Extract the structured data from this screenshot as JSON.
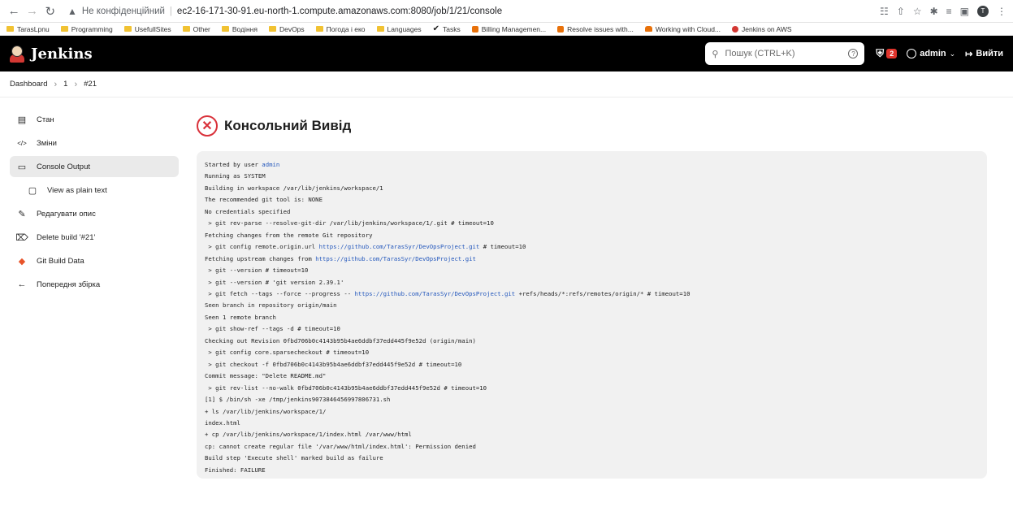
{
  "browser": {
    "insecure_label": "Не конфіденційний",
    "url": "ec2-16-171-30-91.eu-north-1.compute.amazonaws.com:8080/job/1/21/console",
    "profile_initial": "T",
    "bookmarks": [
      {
        "label": "TarasLpnu",
        "icon": "folder-icon"
      },
      {
        "label": "Programming",
        "icon": "folder-icon"
      },
      {
        "label": "UsefullSites",
        "icon": "folder-icon"
      },
      {
        "label": "Other",
        "icon": "folder-icon"
      },
      {
        "label": "Водіння",
        "icon": "folder-icon"
      },
      {
        "label": "DevOps",
        "icon": "folder-icon"
      },
      {
        "label": "Погода і еко",
        "icon": "folder-icon"
      },
      {
        "label": "Languages",
        "icon": "folder-icon"
      },
      {
        "label": "Tasks",
        "icon": "check-icon"
      },
      {
        "label": "Billing Managemen...",
        "icon": "aws-icon"
      },
      {
        "label": "Resolve issues with...",
        "icon": "aws-icon"
      },
      {
        "label": "Working with Cloud...",
        "icon": "cloud-icon"
      },
      {
        "label": "Jenkins on AWS",
        "icon": "jenkins-icon"
      }
    ]
  },
  "header": {
    "brand": "Jenkins",
    "search_placeholder": "Пошук (CTRL+K)",
    "help": "?",
    "alerts_count": "2",
    "user": "admin",
    "logout_label": "Вийти"
  },
  "breadcrumb": {
    "items": [
      "Dashboard",
      "1",
      "#21"
    ]
  },
  "sidebar": {
    "items": [
      {
        "label": "Стан",
        "icon": "document-icon"
      },
      {
        "label": "Зміни",
        "icon": "code-icon"
      },
      {
        "label": "Console Output",
        "icon": "terminal-icon",
        "active": true
      },
      {
        "label": "View as plain text",
        "icon": "file-icon",
        "sub": true
      },
      {
        "label": "Редагувати опис",
        "icon": "edit-icon"
      },
      {
        "label": "Delete build '#21'",
        "icon": "trash-icon"
      },
      {
        "label": "Git Build Data",
        "icon": "git-icon"
      },
      {
        "label": "Попередня збірка",
        "icon": "arrow-left-icon"
      }
    ]
  },
  "main": {
    "title": "Консольний Вивід",
    "status_icon": "failure-icon"
  },
  "console": {
    "lines": [
      {
        "parts": [
          {
            "t": "Started by user "
          },
          {
            "t": "admin",
            "link": true
          }
        ]
      },
      {
        "parts": [
          {
            "t": "Running as SYSTEM"
          }
        ]
      },
      {
        "parts": [
          {
            "t": "Building in workspace /var/lib/jenkins/workspace/1"
          }
        ]
      },
      {
        "parts": [
          {
            "t": "The recommended git tool is: NONE"
          }
        ]
      },
      {
        "parts": [
          {
            "t": "No credentials specified"
          }
        ]
      },
      {
        "parts": [
          {
            "t": " > git rev-parse --resolve-git-dir /var/lib/jenkins/workspace/1/.git # timeout=10"
          }
        ]
      },
      {
        "parts": [
          {
            "t": "Fetching changes from the remote Git repository"
          }
        ]
      },
      {
        "parts": [
          {
            "t": " > git config remote.origin.url "
          },
          {
            "t": "https://github.com/TarasSyr/DevOpsProject.git",
            "link": true
          },
          {
            "t": " # timeout=10"
          }
        ]
      },
      {
        "parts": [
          {
            "t": "Fetching upstream changes from "
          },
          {
            "t": "https://github.com/TarasSyr/DevOpsProject.git",
            "link": true
          }
        ]
      },
      {
        "parts": [
          {
            "t": " > git --version # timeout=10"
          }
        ]
      },
      {
        "parts": [
          {
            "t": " > git --version # 'git version 2.39.1'"
          }
        ]
      },
      {
        "parts": [
          {
            "t": " > git fetch --tags --force --progress -- "
          },
          {
            "t": "https://github.com/TarasSyr/DevOpsProject.git",
            "link": true
          },
          {
            "t": " +refs/heads/*:refs/remotes/origin/* # timeout=10"
          }
        ]
      },
      {
        "parts": [
          {
            "t": "Seen branch in repository origin/main"
          }
        ]
      },
      {
        "parts": [
          {
            "t": "Seen 1 remote branch"
          }
        ]
      },
      {
        "parts": [
          {
            "t": " > git show-ref --tags -d # timeout=10"
          }
        ]
      },
      {
        "parts": [
          {
            "t": "Checking out Revision 0fbd706b0c4143b95b4ae6ddbf37edd445f9e52d (origin/main)"
          }
        ]
      },
      {
        "parts": [
          {
            "t": " > git config core.sparsecheckout # timeout=10"
          }
        ]
      },
      {
        "parts": [
          {
            "t": " > git checkout -f 0fbd706b0c4143b95b4ae6ddbf37edd445f9e52d # timeout=10"
          }
        ]
      },
      {
        "parts": [
          {
            "t": "Commit message: \"Delete README.md\""
          }
        ]
      },
      {
        "parts": [
          {
            "t": " > git rev-list --no-walk 0fbd706b0c4143b95b4ae6ddbf37edd445f9e52d # timeout=10"
          }
        ]
      },
      {
        "parts": [
          {
            "t": "[1] $ /bin/sh -xe /tmp/jenkins9073846456997806731.sh"
          }
        ]
      },
      {
        "parts": [
          {
            "t": "+ ls /var/lib/jenkins/workspace/1/"
          }
        ]
      },
      {
        "parts": [
          {
            "t": "index.html"
          }
        ]
      },
      {
        "parts": [
          {
            "t": "+ cp /var/lib/jenkins/workspace/1/index.html /var/www/html"
          }
        ]
      },
      {
        "parts": [
          {
            "t": "cp: cannot create regular file '/var/www/html/index.html': Permission denied"
          }
        ]
      },
      {
        "parts": [
          {
            "t": "Build step 'Execute shell' marked build as failure"
          }
        ]
      },
      {
        "parts": [
          {
            "t": "Finished: FAILURE"
          }
        ]
      }
    ]
  }
}
